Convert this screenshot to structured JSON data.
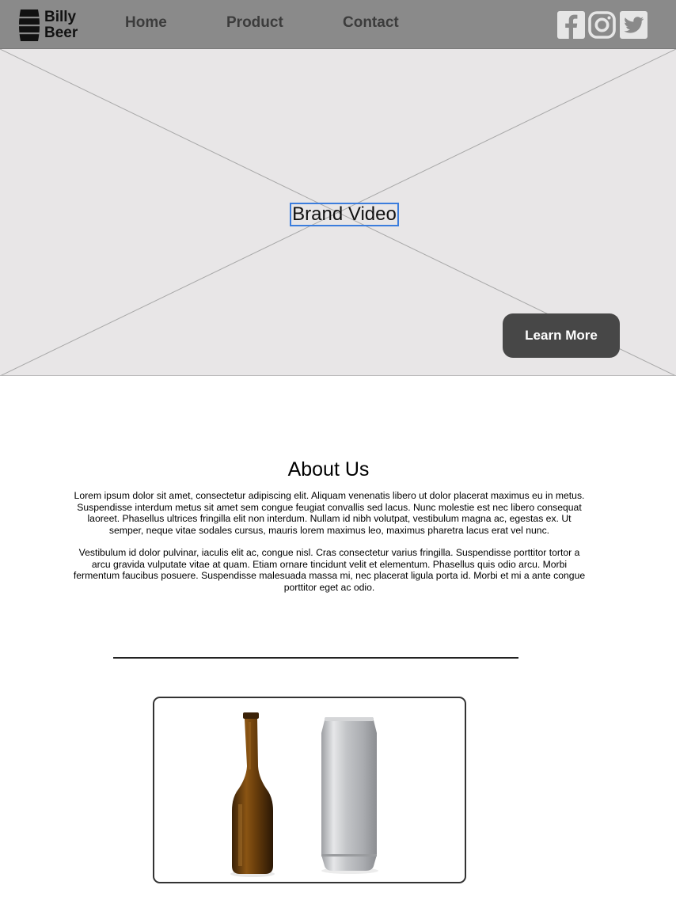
{
  "brand": {
    "line1": "Billy",
    "line2": "Beer",
    "logo_icon": "barrel-icon"
  },
  "nav": {
    "items": [
      {
        "label": "Home"
      },
      {
        "label": "Product"
      },
      {
        "label": "Contact"
      }
    ]
  },
  "social": [
    {
      "name": "facebook-icon"
    },
    {
      "name": "instagram-icon"
    },
    {
      "name": "twitter-icon"
    }
  ],
  "hero": {
    "label": "Brand Video",
    "button_label": "Learn More"
  },
  "about": {
    "title": "About Us",
    "paragraphs": [
      "Lorem ipsum dolor sit amet, consectetur adipiscing elit. Aliquam venenatis libero ut dolor placerat maximus eu in metus. Suspendisse interdum metus sit amet sem congue feugiat convallis sed lacus. Nunc molestie est nec libero consequat laoreet. Phasellus ultrices fringilla elit non interdum. Nullam id nibh volutpat, vestibulum magna ac, egestas ex. Ut semper, neque vitae sodales cursus, mauris lorem maximus leo, maximus pharetra lacus erat vel nunc.",
      "Vestibulum id dolor pulvinar, iaculis elit ac, congue nisl. Cras consectetur varius fringilla. Suspendisse porttitor tortor a arcu gravida vulputate vitae at quam. Etiam ornare tincidunt velit et elementum. Phasellus quis odio arcu. Morbi fermentum faucibus posuere. Suspendisse malesuada massa mi, nec placerat ligula porta id. Morbi et mi a ante congue porttitor eget ac odio."
    ]
  },
  "products": {
    "images": [
      {
        "name": "beer-bottle-image"
      },
      {
        "name": "beer-can-image"
      }
    ]
  },
  "colors": {
    "header_bg": "#8a8a8a",
    "hero_bg": "#e8e6e7",
    "button_bg": "#474747",
    "selection_outline": "#3b7ddd"
  }
}
